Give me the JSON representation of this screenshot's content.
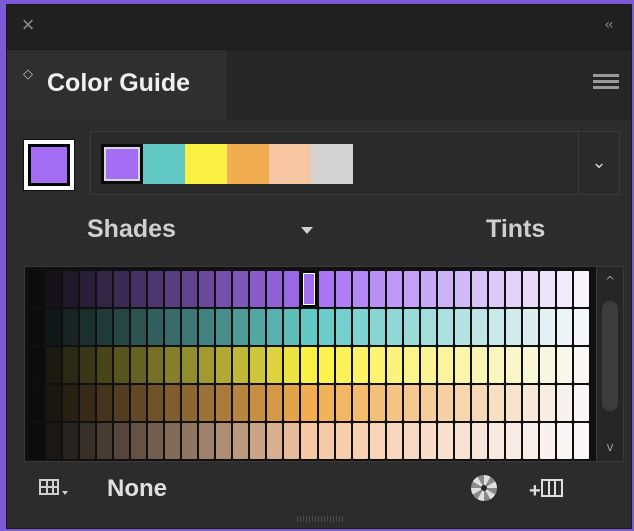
{
  "window": {
    "close_icon": "close-icon",
    "collapse_icon": "collapse-double-chevron-icon",
    "close_glyph": "×",
    "collapse_glyph": "‹‹"
  },
  "tab": {
    "title": "Color Guide",
    "reorder_glyph": "◇",
    "menu_icon": "panel-menu-icon"
  },
  "base_color": "#a36ef3",
  "harmony": {
    "colors": [
      "#a36ef3",
      "#63c9c5",
      "#fbf144",
      "#f1ad4f",
      "#f6c7a2",
      "#d3d3d3"
    ],
    "dropdown_glyph": "⌄"
  },
  "labels": {
    "left": "Shades",
    "right": "Tints"
  },
  "variations": {
    "rows": [
      "#a36ef3",
      "#63c9c5",
      "#fbf144",
      "#f1ad4f",
      "#f6c7a2"
    ],
    "selected_row": 0,
    "selected_column": 16,
    "scroll_up_glyph": "^",
    "scroll_down_glyph": "v"
  },
  "footer": {
    "limit_label": "None",
    "grid_icon": "variation-grid-options-icon",
    "wheel_icon": "edit-colors-wheel-icon",
    "save_icon": "save-group-to-swatches-icon"
  }
}
